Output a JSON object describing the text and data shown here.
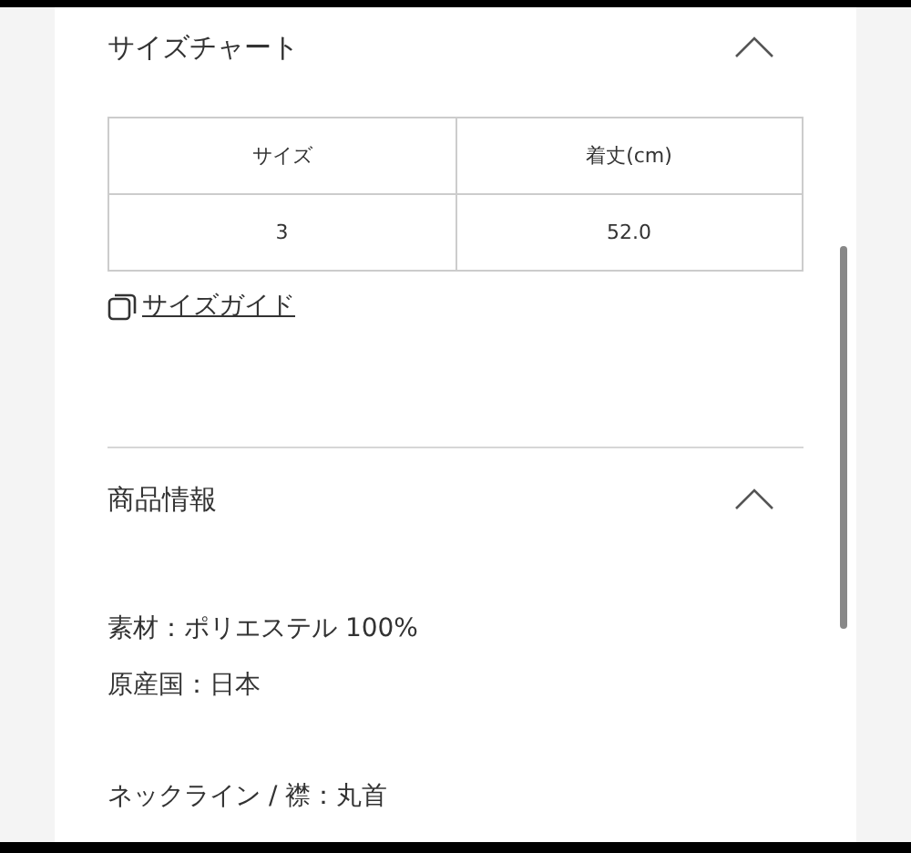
{
  "sections": [
    {
      "title": "サイズチャート",
      "expanded": true,
      "kind": "table",
      "table": {
        "columns": [
          "サイズ",
          "着丈(cm)"
        ],
        "rows": [
          [
            "3",
            "52.0"
          ]
        ]
      },
      "link": "サイズガイド"
    },
    {
      "title": "商品情報",
      "expanded": true,
      "kind": "info",
      "lines": [
        [
          "素材：ポリエステル 100%",
          "原産国：日本"
        ],
        [
          "ネックライン / 襟：丸首"
        ]
      ]
    }
  ]
}
